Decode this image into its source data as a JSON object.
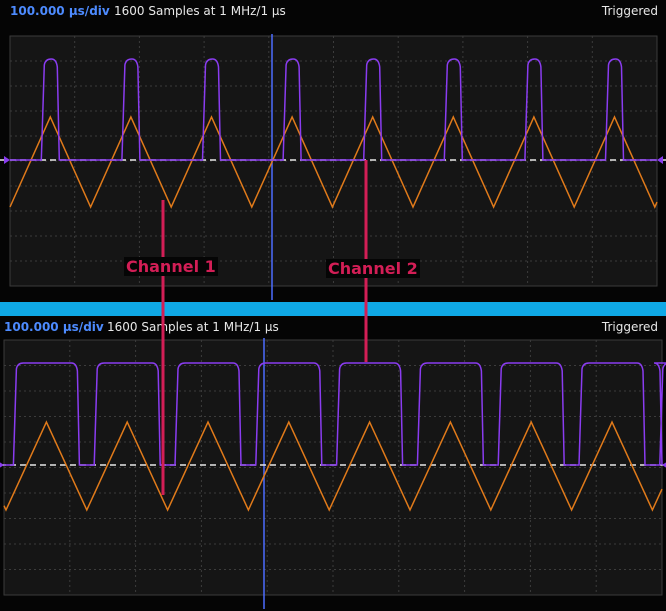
{
  "top_panel": {
    "timebase": "100.000 µs/div",
    "samples": "1600 Samples at 1 MHz/1 µs",
    "status": "Triggered"
  },
  "bottom_panel": {
    "timebase": "100.000 µs/div",
    "samples": "1600 Samples at 1 MHz/1 µs",
    "status": "Triggered"
  },
  "annotations": {
    "channel1": "Channel 1",
    "channel2": "Channel 2"
  },
  "colors": {
    "digital_trace": "#8a3cf0",
    "analog_trace": "#e07a1a",
    "cursor": "#4d6cff",
    "ground": "#e6e6e6",
    "callout": "#d31e56",
    "divider": "#0fa9e6"
  }
}
